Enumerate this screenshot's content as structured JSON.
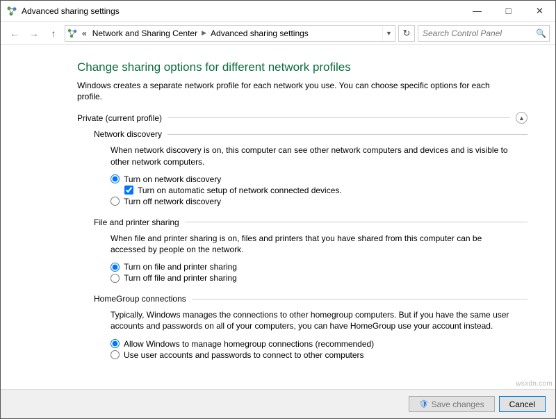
{
  "window": {
    "title": "Advanced sharing settings"
  },
  "nav": {
    "breadcrumb_root": "«",
    "breadcrumb0": "Network and Sharing Center",
    "breadcrumb1": "Advanced sharing settings"
  },
  "search": {
    "placeholder": "Search Control Panel"
  },
  "main": {
    "heading": "Change sharing options for different network profiles",
    "description": "Windows creates a separate network profile for each network you use. You can choose specific options for each profile."
  },
  "profile": {
    "label": "Private (current profile)"
  },
  "netdisc": {
    "title": "Network discovery",
    "desc": "When network discovery is on, this computer can see other network computers and devices and is visible to other network computers.",
    "opt_on": "Turn on network discovery",
    "opt_auto": "Turn on automatic setup of network connected devices.",
    "opt_off": "Turn off network discovery"
  },
  "fileshare": {
    "title": "File and printer sharing",
    "desc": "When file and printer sharing is on, files and printers that you have shared from this computer can be accessed by people on the network.",
    "opt_on": "Turn on file and printer sharing",
    "opt_off": "Turn off file and printer sharing"
  },
  "homegroup": {
    "title": "HomeGroup connections",
    "desc": "Typically, Windows manages the connections to other homegroup computers. But if you have the same user accounts and passwords on all of your computers, you can have HomeGroup use your account instead.",
    "opt_allow": "Allow Windows to manage homegroup connections (recommended)",
    "opt_user": "Use user accounts and passwords to connect to other computers"
  },
  "footer": {
    "save": "Save changes",
    "cancel": "Cancel"
  },
  "watermark": "wsxdn.com"
}
